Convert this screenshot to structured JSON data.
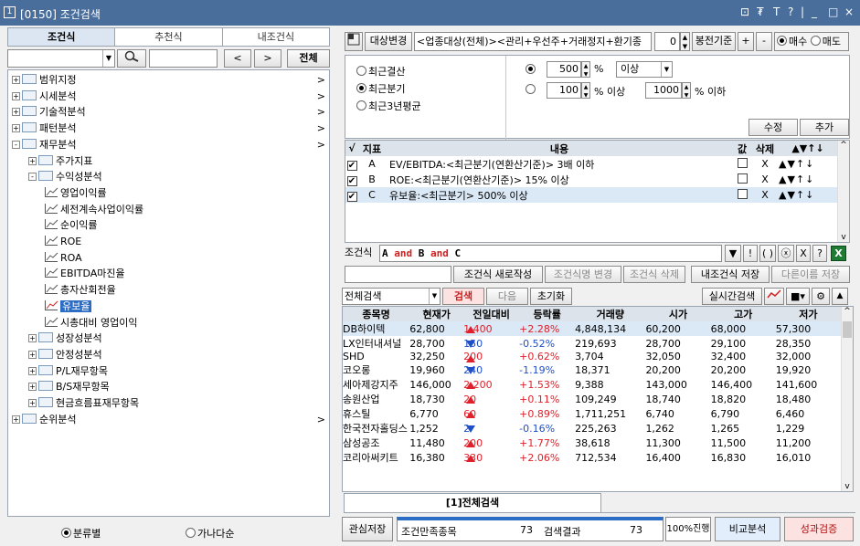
{
  "window": {
    "number": "1",
    "title": "[0150] 조건검색"
  },
  "left": {
    "tabs": [
      "조건식",
      "추천식",
      "내조건식"
    ],
    "search_btn_prev": "<",
    "search_btn_next": ">",
    "search_btn_all": "전체",
    "tree": [
      {
        "label": "범위지정",
        "level": 0,
        "expand": "+",
        "arrow": ">"
      },
      {
        "label": "시세분석",
        "level": 0,
        "expand": "+",
        "arrow": ">"
      },
      {
        "label": "기술적분석",
        "level": 0,
        "expand": "+",
        "arrow": ">"
      },
      {
        "label": "패턴분석",
        "level": 0,
        "expand": "+",
        "arrow": ">"
      },
      {
        "label": "재무분석",
        "level": 0,
        "expand": "-",
        "arrow": ">"
      },
      {
        "label": "주가지표",
        "level": 1,
        "expand": "+"
      },
      {
        "label": "수익성분석",
        "level": 1,
        "expand": "-"
      },
      {
        "label": "영업이익률",
        "level": 2
      },
      {
        "label": "세전계속사업이익률",
        "level": 2
      },
      {
        "label": "순이익률",
        "level": 2
      },
      {
        "label": "ROE",
        "level": 2
      },
      {
        "label": "ROA",
        "level": 2
      },
      {
        "label": "EBITDA마진율",
        "level": 2
      },
      {
        "label": "총자산회전율",
        "level": 2
      },
      {
        "label": "유보율",
        "level": 2,
        "selected": true
      },
      {
        "label": "시총대비 영업이익",
        "level": 2
      },
      {
        "label": "성장성분석",
        "level": 1,
        "expand": "+"
      },
      {
        "label": "안정성분석",
        "level": 1,
        "expand": "+"
      },
      {
        "label": "P/L재무항목",
        "level": 1,
        "expand": "+"
      },
      {
        "label": "B/S재무항목",
        "level": 1,
        "expand": "+"
      },
      {
        "label": "현금흐름표재무항목",
        "level": 1,
        "expand": "+"
      },
      {
        "label": "순위분석",
        "level": 0,
        "expand": "+",
        "arrow": ">"
      }
    ],
    "radio": {
      "opt1": "분류별",
      "opt2": "가나다순"
    }
  },
  "toolbar": {
    "target_btn": "대상변경",
    "target_text": "<업종대상(전체)><관리+우선주+거래정지+환기종",
    "spin_value": "0",
    "candle_basis": "봉전기준",
    "plus": "+",
    "minus": "-",
    "buy": "매수",
    "sell": "매도"
  },
  "period": {
    "opt1": "최근결산",
    "opt2": "최근분기",
    "opt3": "최근3년평균",
    "val1": "500",
    "pct1": "%",
    "cmp1": "이상",
    "val2": "100",
    "pct2": "% 이상",
    "val3": "1000",
    "pct3": "% 이하",
    "modify": "수정",
    "add": "추가"
  },
  "conditions": {
    "headers": [
      "√",
      "지표",
      "내용",
      "값",
      "삭제",
      "▲▼↑↓"
    ],
    "rows": [
      {
        "id": "A",
        "content": "EV/EBITDA:<최근분기(연환산기준)> 3배 이하",
        "del": "X"
      },
      {
        "id": "B",
        "content": "ROE:<최근분기(연환산기준)> 15% 이상",
        "del": "X"
      },
      {
        "id": "C",
        "content": "유보율:<최근분기> 500% 이상",
        "del": "X"
      }
    ],
    "formula_label": "조건식",
    "formula_parts": [
      "A",
      "and",
      "B",
      "and",
      "C"
    ],
    "formula_btns": [
      "▼",
      "!",
      "( )",
      "ⓧ",
      "X",
      "?"
    ]
  },
  "actions": {
    "new": "조건식 새로작성",
    "rename": "조건식명 변경",
    "delete": "조건식 삭제",
    "save": "내조건식 저장",
    "saveas": "다른이름 저장"
  },
  "searchbar": {
    "scope": "전체검색",
    "search": "검색",
    "next": "다음",
    "reset": "초기화",
    "realtime": "실시간검색"
  },
  "results": {
    "headers": [
      "종목명",
      "현재가",
      "전일대비",
      "등락률",
      "거래량",
      "시가",
      "고가",
      "저가"
    ],
    "rows": [
      {
        "name": "DB하이텍",
        "price": "62,800",
        "dir": "up",
        "chg": "1,400",
        "rate": "+2.28%",
        "vol": "4,848,134",
        "open": "60,200",
        "high": "68,000",
        "low": "57,300"
      },
      {
        "name": "LX인터내셔널",
        "price": "28,700",
        "dir": "dn",
        "chg": "150",
        "rate": "-0.52%",
        "vol": "219,693",
        "open": "28,700",
        "high": "29,100",
        "low": "28,350"
      },
      {
        "name": "SHD",
        "price": "32,250",
        "dir": "up",
        "chg": "200",
        "rate": "+0.62%",
        "vol": "3,704",
        "open": "32,050",
        "high": "32,400",
        "low": "32,000"
      },
      {
        "name": "코오롱",
        "price": "19,960",
        "dir": "dn",
        "chg": "240",
        "rate": "-1.19%",
        "vol": "18,371",
        "open": "20,200",
        "high": "20,200",
        "low": "19,920"
      },
      {
        "name": "세아제강지주",
        "price": "146,000",
        "dir": "up",
        "chg": "2,200",
        "rate": "+1.53%",
        "vol": "9,388",
        "open": "143,000",
        "high": "146,400",
        "low": "141,600"
      },
      {
        "name": "송원산업",
        "price": "18,730",
        "dir": "up",
        "chg": "20",
        "rate": "+0.11%",
        "vol": "109,249",
        "open": "18,740",
        "high": "18,820",
        "low": "18,480"
      },
      {
        "name": "휴스틸",
        "price": "6,770",
        "dir": "up",
        "chg": "60",
        "rate": "+0.89%",
        "vol": "1,711,251",
        "open": "6,740",
        "high": "6,790",
        "low": "6,460"
      },
      {
        "name": "한국전자홀딩스",
        "price": "1,252",
        "dir": "dn",
        "chg": "2",
        "rate": "-0.16%",
        "vol": "225,263",
        "open": "1,262",
        "high": "1,265",
        "low": "1,229"
      },
      {
        "name": "삼성공조",
        "price": "11,480",
        "dir": "up",
        "chg": "200",
        "rate": "+1.77%",
        "vol": "38,618",
        "open": "11,300",
        "high": "11,500",
        "low": "11,200"
      },
      {
        "name": "코리아써키트",
        "price": "16,380",
        "dir": "up",
        "chg": "330",
        "rate": "+2.06%",
        "vol": "712,534",
        "open": "16,400",
        "high": "16,830",
        "low": "16,010"
      }
    ],
    "tab": "[1]전체검색"
  },
  "status": {
    "watch_save": "관심저장",
    "cond_count_label": "조건만족종목",
    "cond_count": "73",
    "result_label": "검색결과",
    "result_count": "73",
    "progress_text": "100%진행",
    "progress": 1.0,
    "compare": "비교분석",
    "verify": "성과검증"
  },
  "colors": {
    "titlebar": "#4a6e9c",
    "up": "#e0202a",
    "down": "#1f4fc8",
    "select": "#2b6cc4",
    "selected_row": "#dbe8f6"
  }
}
